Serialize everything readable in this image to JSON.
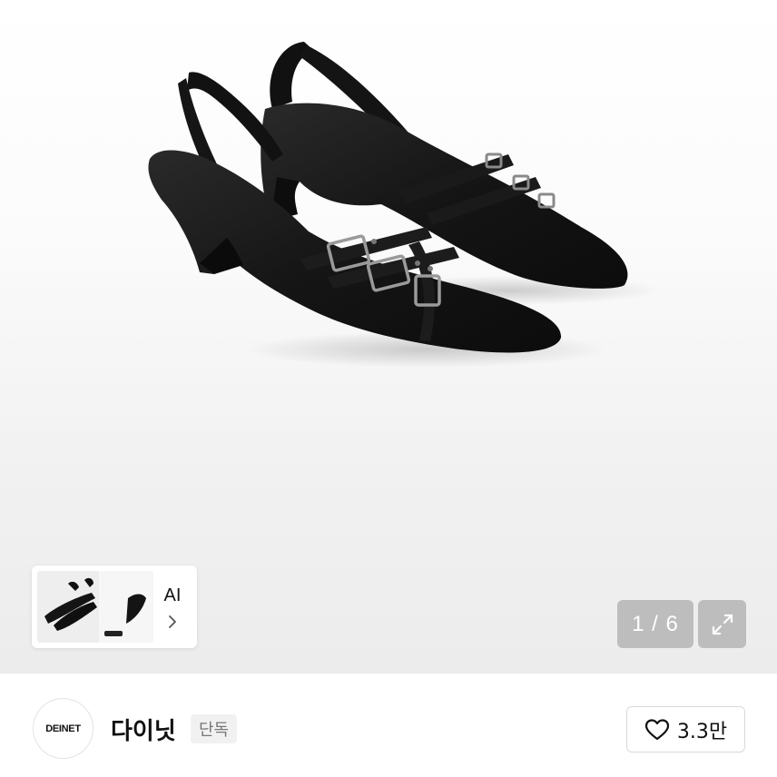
{
  "gallery": {
    "image_alt": "Black pointed-toe slingback wedge shoes with buckle straps",
    "ai_card": {
      "label": "AI"
    },
    "counter": "1 / 6"
  },
  "brand": {
    "logo_text": "DEINET",
    "name": "다이닛",
    "tag": "단독"
  },
  "like": {
    "count": "3.3만"
  },
  "icons": {
    "chevron": "chevron-right-icon",
    "expand": "expand-icon",
    "heart": "heart-icon"
  }
}
